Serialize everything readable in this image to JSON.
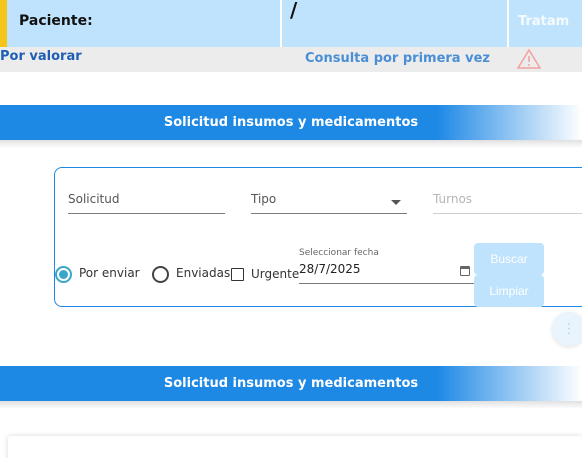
{
  "patient": {
    "label": "Paciente:",
    "separator": "/",
    "trailing_label": "Tratam",
    "status_left": "Por valorar",
    "status_center": "Consulta por primera vez",
    "warning_icon": "warning-triangle-icon",
    "accent_color": "#f5c518",
    "bar_color": "#bfe3fd"
  },
  "sections": [
    {
      "title": "Solicitud insumos y medicamentos"
    },
    {
      "title": "Solicitud insumos y medicamentos"
    }
  ],
  "filters": {
    "solicitud_label": "Solicitud",
    "tipo_label": "Tipo",
    "turnos_label": "Turnos",
    "radio_options": [
      {
        "label": "Por enviar",
        "checked": true
      },
      {
        "label": "Enviadas",
        "checked": false
      }
    ],
    "urgente_label": "Urgente",
    "date_label": "Seleccionar fecha",
    "date_value": "28/7/2025",
    "search_button": "Buscar",
    "clear_button": "Limpiar"
  },
  "colors": {
    "banner": "#1e88e5",
    "radio_checked": "#3aa6c9",
    "button_disabled": "#bfe3fd"
  }
}
